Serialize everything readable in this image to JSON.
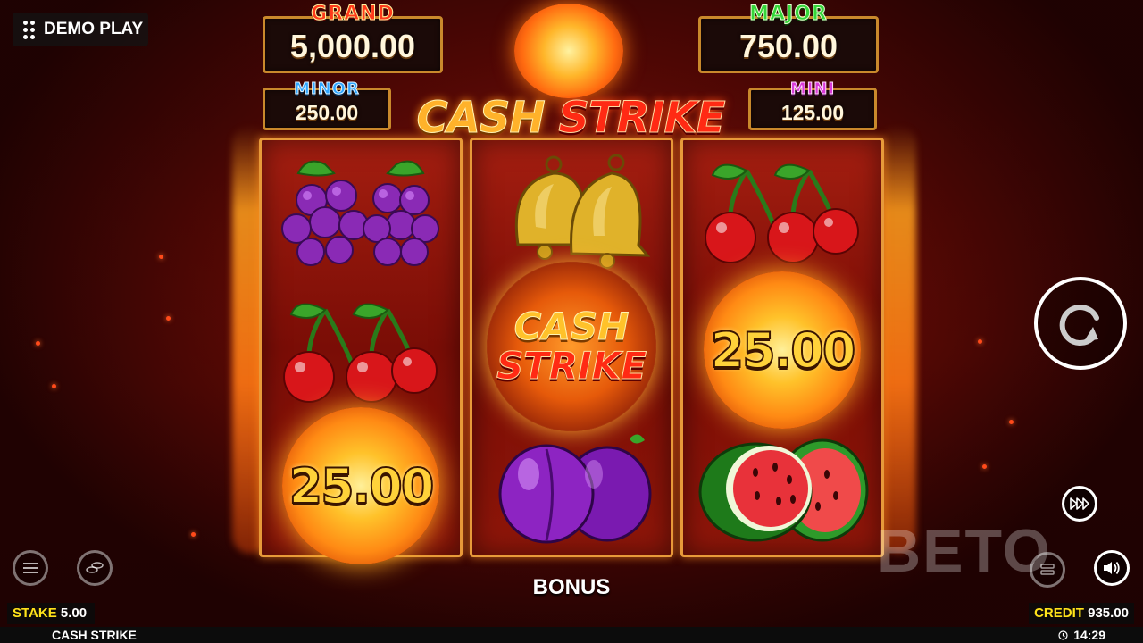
{
  "header": {
    "demo_label": "DEMO PLAY"
  },
  "jackpots": {
    "grand": {
      "label": "GRAND",
      "value": "5,000.00"
    },
    "major": {
      "label": "MAJOR",
      "value": "750.00"
    },
    "minor": {
      "label": "MINOR",
      "value": "250.00"
    },
    "mini": {
      "label": "MINI",
      "value": "125.00"
    }
  },
  "logo": {
    "word1": "CASH",
    "word2": "STRIKE"
  },
  "reels": [
    [
      "grapes",
      "cherries",
      "coin:25.00"
    ],
    [
      "bells",
      "cash-strike",
      "plums"
    ],
    [
      "cherries",
      "coin:25.00",
      "watermelon"
    ]
  ],
  "coin_values": {
    "reel1_row3": "25.00",
    "reel3_row2": "25.00"
  },
  "cash_strike_symbol": {
    "line1": "CASH",
    "line2": "STRIKE"
  },
  "status": {
    "bonus_label": "BONUS",
    "stake_label": "STAKE",
    "stake_value": "5.00",
    "credit_label": "CREDIT",
    "credit_value": "935.00",
    "game_name": "CASH STRIKE",
    "time": "14:29"
  },
  "watermark": "BETO",
  "colors": {
    "accent_gold": "#e79a3a",
    "stake_credit_label": "#ffe21a",
    "grand": "#ff3a1a",
    "major": "#35d53a",
    "minor": "#2ea6ff",
    "mini": "#d93ad9"
  }
}
